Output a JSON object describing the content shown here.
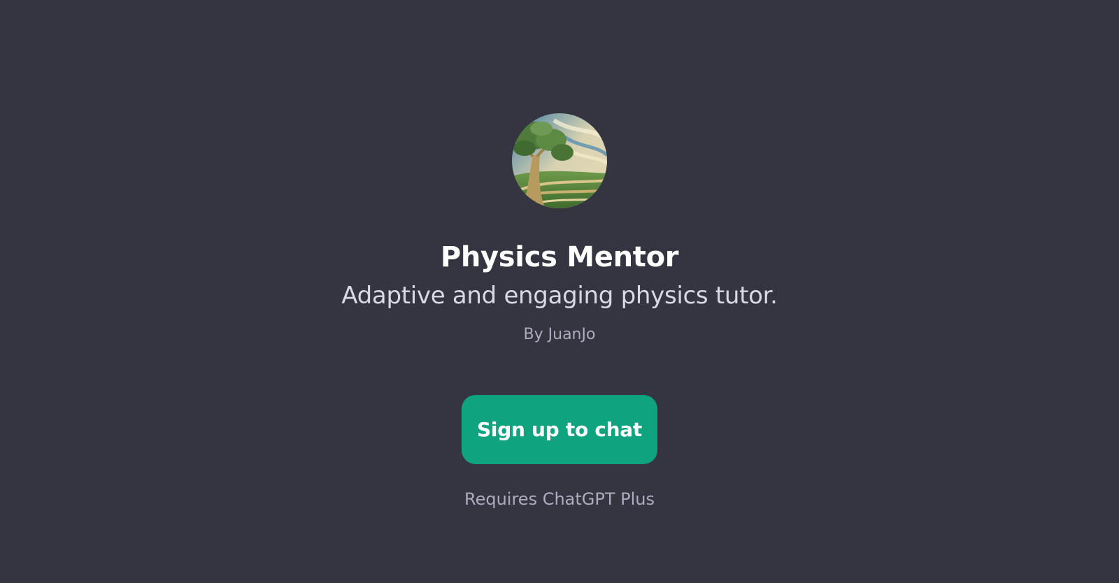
{
  "gpt": {
    "name": "Physics Mentor",
    "description": "Adaptive and engaging physics tutor.",
    "author": "By JuanJo",
    "avatar_icon": "tree-landscape-avatar-icon"
  },
  "actions": {
    "signup_label": "Sign up to chat"
  },
  "footer": {
    "requirement": "Requires ChatGPT Plus"
  },
  "colors": {
    "background": "#343541",
    "accent": "#10a37f",
    "title": "#ffffff",
    "subtitle": "#d9d9e3",
    "muted": "#acacbe"
  }
}
